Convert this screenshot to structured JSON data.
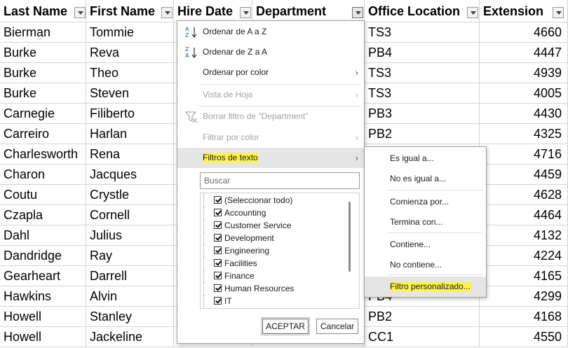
{
  "columns": [
    "Last Name",
    "First Name",
    "Hire Date",
    "Department",
    "Office Location",
    "Extension"
  ],
  "rows": [
    {
      "last": "Bierman",
      "first": "Tommie",
      "office": "TS3",
      "ext": "4660"
    },
    {
      "last": "Burke",
      "first": "Reva",
      "office": "PB4",
      "ext": "4447"
    },
    {
      "last": "Burke",
      "first": "Theo",
      "office": "TS3",
      "ext": "4939"
    },
    {
      "last": "Burke",
      "first": "Steven",
      "office": "TS3",
      "ext": "4005"
    },
    {
      "last": "Carnegie",
      "first": "Filiberto",
      "office": "PB3",
      "ext": "4430"
    },
    {
      "last": "Carreiro",
      "first": "Harlan",
      "office": "PB2",
      "ext": "4325"
    },
    {
      "last": "Charlesworth",
      "first": "Rena",
      "office": "",
      "ext": "4716"
    },
    {
      "last": "Charon",
      "first": "Jacques",
      "office": "",
      "ext": "4459"
    },
    {
      "last": "Coutu",
      "first": "Crystle",
      "office": "",
      "ext": "4628"
    },
    {
      "last": "Czapla",
      "first": "Cornell",
      "office": "",
      "ext": "4464"
    },
    {
      "last": "Dahl",
      "first": "Julius",
      "office": "",
      "ext": "4132"
    },
    {
      "last": "Dandridge",
      "first": "Ray",
      "office": "",
      "ext": "4224"
    },
    {
      "last": "Gearheart",
      "first": "Darrell",
      "office": "",
      "ext": "4165"
    },
    {
      "last": "Hawkins",
      "first": "Alvin",
      "office": "PB4",
      "ext": "4299"
    },
    {
      "last": "Howell",
      "first": "Stanley",
      "office": "PB2",
      "ext": "4168"
    },
    {
      "last": "Howell",
      "first": "Jackeline",
      "office": "CC1",
      "ext": "4550"
    }
  ],
  "filter_menu": {
    "sort_az": "Ordenar de A a Z",
    "sort_za": "Ordenar de Z a A",
    "sort_color": "Ordenar por color",
    "sheet_view": "Vista de Hoja",
    "clear_filter": "Borrar filtro de \"Department\"",
    "filter_color": "Filtrar por color",
    "text_filters": "Filtros de texto",
    "search_placeholder": "Buscar",
    "items": [
      "(Seleccionar todo)",
      "Accounting",
      "Customer Service",
      "Development",
      "Engineering",
      "Facilities",
      "Finance",
      "Human Resources",
      "IT"
    ],
    "ok": "ACEPTAR",
    "cancel": "Cancelar"
  },
  "text_filter_submenu": [
    "Es igual a...",
    "No es igual a...",
    "Comienza por...",
    "Termina con...",
    "Contiene...",
    "No contiene...",
    "Filtro personalizado..."
  ],
  "colors": {
    "highlight": "#fff34d",
    "grid": "#d4d4d4"
  }
}
